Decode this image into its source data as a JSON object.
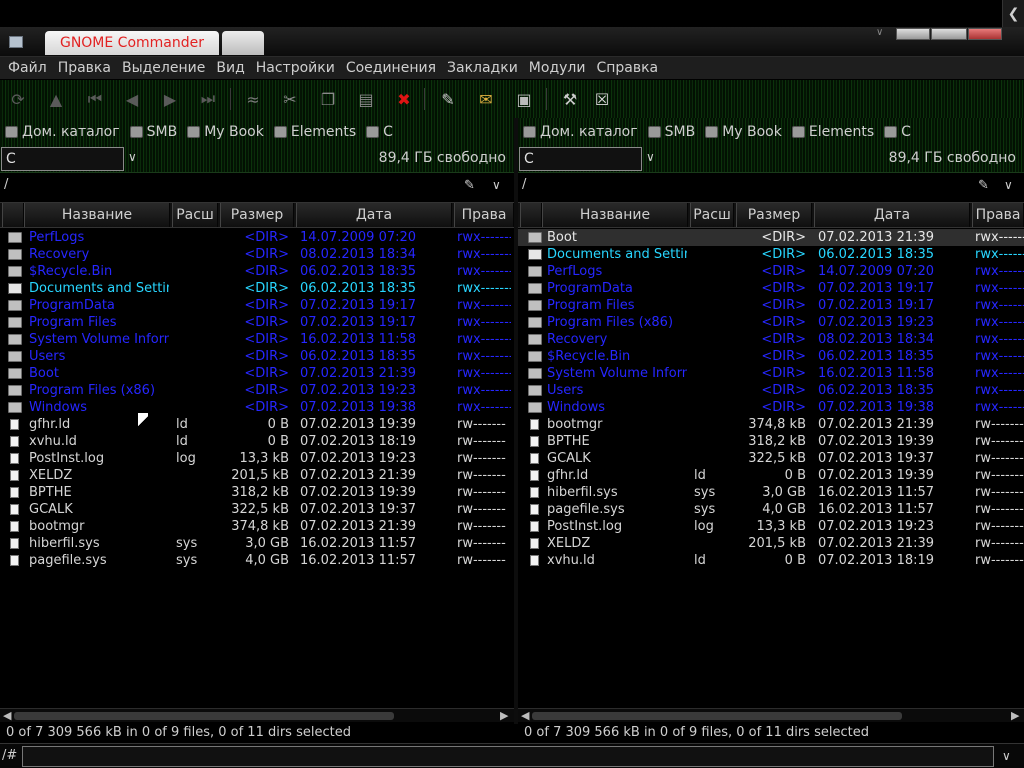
{
  "window": {
    "title": "GNOME Commander"
  },
  "menu": [
    "Файл",
    "Правка",
    "Выделение",
    "Вид",
    "Настройки",
    "Соединения",
    "Закладки",
    "Модули",
    "Справка"
  ],
  "toolbar": [
    "refresh-icon",
    "up-icon",
    "first-icon",
    "back-icon",
    "forward-icon",
    "last-icon",
    "connect-icon",
    "cut-icon",
    "copy-icon",
    "paste-icon",
    "delete-icon",
    "edit-icon",
    "mail-icon",
    "terminal-icon",
    "tool-icon",
    "close-panel-icon"
  ],
  "bookmarks": [
    "Дом. каталог",
    "SMB",
    "My Book",
    "Elements",
    "C"
  ],
  "columns": {
    "name": "Название",
    "ext": "Расш",
    "size": "Размер",
    "date": "Дата",
    "perm": "Права"
  },
  "left": {
    "drive": "C",
    "free": "89,4 ГБ свободно",
    "path": "/",
    "status": "0  of 7 309 566  kB in 0 of 9 files, 0 of 11 dirs selected",
    "rows": [
      {
        "type": "dir",
        "name": "PerfLogs",
        "ext": "",
        "size": "<DIR>",
        "date": "14.07.2009 07:20",
        "perm": "rwx-------"
      },
      {
        "type": "dir",
        "name": "Recovery",
        "ext": "",
        "size": "<DIR>",
        "date": "08.02.2013 18:34",
        "perm": "rwx-------"
      },
      {
        "type": "dir",
        "name": "$Recycle.Bin",
        "ext": "",
        "size": "<DIR>",
        "date": "06.02.2013 18:35",
        "perm": "rwx-------"
      },
      {
        "type": "dirlink",
        "name": "Documents and Settings",
        "ext": "",
        "size": "<DIR>",
        "date": "06.02.2013 18:35",
        "perm": "rwx-------"
      },
      {
        "type": "dir",
        "name": "ProgramData",
        "ext": "",
        "size": "<DIR>",
        "date": "07.02.2013 19:17",
        "perm": "rwx-------"
      },
      {
        "type": "dir",
        "name": "Program Files",
        "ext": "",
        "size": "<DIR>",
        "date": "07.02.2013 19:17",
        "perm": "rwx-------"
      },
      {
        "type": "dir",
        "name": "System Volume Information",
        "ext": "",
        "size": "<DIR>",
        "date": "16.02.2013 11:58",
        "perm": "rwx-------"
      },
      {
        "type": "dir",
        "name": "Users",
        "ext": "",
        "size": "<DIR>",
        "date": "06.02.2013 18:35",
        "perm": "rwx-------"
      },
      {
        "type": "dir",
        "name": "Boot",
        "ext": "",
        "size": "<DIR>",
        "date": "07.02.2013 21:39",
        "perm": "rwx-------"
      },
      {
        "type": "dir",
        "name": "Program Files (x86)",
        "ext": "",
        "size": "<DIR>",
        "date": "07.02.2013 19:23",
        "perm": "rwx-------"
      },
      {
        "type": "dir",
        "name": "Windows",
        "ext": "",
        "size": "<DIR>",
        "date": "07.02.2013 19:38",
        "perm": "rwx-------"
      },
      {
        "type": "file",
        "name": "gfhr.ld",
        "ext": "ld",
        "size": "0 B",
        "date": "07.02.2013 19:39",
        "perm": "rw-------"
      },
      {
        "type": "file",
        "name": "xvhu.ld",
        "ext": "ld",
        "size": "0 B",
        "date": "07.02.2013 18:19",
        "perm": "rw-------"
      },
      {
        "type": "file",
        "name": "PostInst.log",
        "ext": "log",
        "size": "13,3 kB",
        "date": "07.02.2013 19:23",
        "perm": "rw-------"
      },
      {
        "type": "file",
        "name": "XELDZ",
        "ext": "",
        "size": "201,5 kB",
        "date": "07.02.2013 21:39",
        "perm": "rw-------"
      },
      {
        "type": "file",
        "name": "BPTHE",
        "ext": "",
        "size": "318,2 kB",
        "date": "07.02.2013 19:39",
        "perm": "rw-------"
      },
      {
        "type": "file",
        "name": "GCALK",
        "ext": "",
        "size": "322,5 kB",
        "date": "07.02.2013 19:37",
        "perm": "rw-------"
      },
      {
        "type": "file",
        "name": "bootmgr",
        "ext": "",
        "size": "374,8 kB",
        "date": "07.02.2013 21:39",
        "perm": "rw-------"
      },
      {
        "type": "file",
        "name": "hiberfil.sys",
        "ext": "sys",
        "size": "3,0 GB",
        "date": "16.02.2013 11:57",
        "perm": "rw-------"
      },
      {
        "type": "file",
        "name": "pagefile.sys",
        "ext": "sys",
        "size": "4,0 GB",
        "date": "16.02.2013 11:57",
        "perm": "rw-------"
      }
    ]
  },
  "right": {
    "drive": "C",
    "free": "89,4 ГБ свободно",
    "path": "/",
    "status": "0  of 7 309 566  kB in 0 of 9 files, 0 of 11 dirs selected",
    "rows": [
      {
        "type": "dir",
        "name": "Boot",
        "ext": "",
        "size": "<DIR>",
        "date": "07.02.2013 21:39",
        "perm": "rwx-------",
        "selected": true
      },
      {
        "type": "dirlink",
        "name": "Documents and Settings",
        "ext": "",
        "size": "<DIR>",
        "date": "06.02.2013 18:35",
        "perm": "rwx-------"
      },
      {
        "type": "dir",
        "name": "PerfLogs",
        "ext": "",
        "size": "<DIR>",
        "date": "14.07.2009 07:20",
        "perm": "rwx-------"
      },
      {
        "type": "dir",
        "name": "ProgramData",
        "ext": "",
        "size": "<DIR>",
        "date": "07.02.2013 19:17",
        "perm": "rwx-------"
      },
      {
        "type": "dir",
        "name": "Program Files",
        "ext": "",
        "size": "<DIR>",
        "date": "07.02.2013 19:17",
        "perm": "rwx-------"
      },
      {
        "type": "dir",
        "name": "Program Files (x86)",
        "ext": "",
        "size": "<DIR>",
        "date": "07.02.2013 19:23",
        "perm": "rwx-------"
      },
      {
        "type": "dir",
        "name": "Recovery",
        "ext": "",
        "size": "<DIR>",
        "date": "08.02.2013 18:34",
        "perm": "rwx-------"
      },
      {
        "type": "dir",
        "name": "$Recycle.Bin",
        "ext": "",
        "size": "<DIR>",
        "date": "06.02.2013 18:35",
        "perm": "rwx-------"
      },
      {
        "type": "dir",
        "name": "System Volume Information",
        "ext": "",
        "size": "<DIR>",
        "date": "16.02.2013 11:58",
        "perm": "rwx-------"
      },
      {
        "type": "dir",
        "name": "Users",
        "ext": "",
        "size": "<DIR>",
        "date": "06.02.2013 18:35",
        "perm": "rwx-------"
      },
      {
        "type": "dir",
        "name": "Windows",
        "ext": "",
        "size": "<DIR>",
        "date": "07.02.2013 19:38",
        "perm": "rwx-------"
      },
      {
        "type": "file",
        "name": "bootmgr",
        "ext": "",
        "size": "374,8 kB",
        "date": "07.02.2013 21:39",
        "perm": "rw-------"
      },
      {
        "type": "file",
        "name": "BPTHE",
        "ext": "",
        "size": "318,2 kB",
        "date": "07.02.2013 19:39",
        "perm": "rw-------"
      },
      {
        "type": "file",
        "name": "GCALK",
        "ext": "",
        "size": "322,5 kB",
        "date": "07.02.2013 19:37",
        "perm": "rw-------"
      },
      {
        "type": "file",
        "name": "gfhr.ld",
        "ext": "ld",
        "size": "0 B",
        "date": "07.02.2013 19:39",
        "perm": "rw-------"
      },
      {
        "type": "file",
        "name": "hiberfil.sys",
        "ext": "sys",
        "size": "3,0 GB",
        "date": "16.02.2013 11:57",
        "perm": "rw-------"
      },
      {
        "type": "file",
        "name": "pagefile.sys",
        "ext": "sys",
        "size": "4,0 GB",
        "date": "16.02.2013 11:57",
        "perm": "rw-------"
      },
      {
        "type": "file",
        "name": "PostInst.log",
        "ext": "log",
        "size": "13,3 kB",
        "date": "07.02.2013 19:23",
        "perm": "rw-------"
      },
      {
        "type": "file",
        "name": "XELDZ",
        "ext": "",
        "size": "201,5 kB",
        "date": "07.02.2013 21:39",
        "perm": "rw-------"
      },
      {
        "type": "file",
        "name": "xvhu.ld",
        "ext": "ld",
        "size": "0 B",
        "date": "07.02.2013 18:19",
        "perm": "rw-------"
      }
    ]
  },
  "cmdline": {
    "prompt": "/#"
  },
  "colors": {
    "dir": "#2626ff",
    "dirlink": "#28d6ff",
    "file": "#d6d6d6",
    "title": "#e22222"
  }
}
